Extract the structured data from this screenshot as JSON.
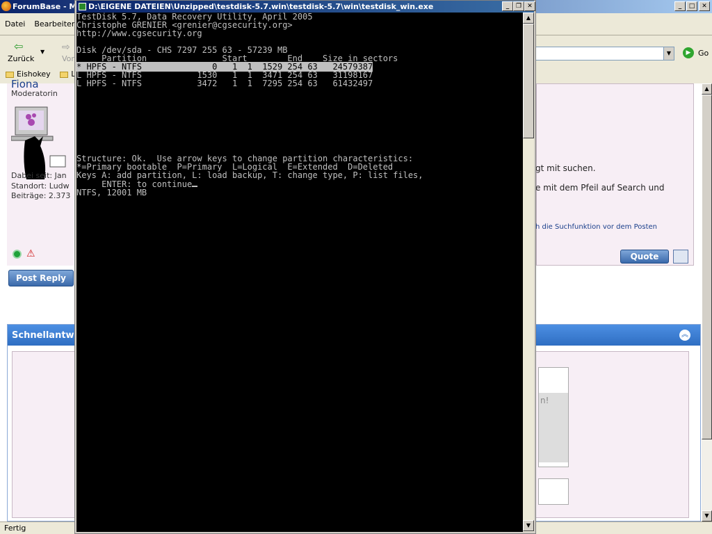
{
  "browser": {
    "title": "ForumBase - M",
    "menu": [
      "Datei",
      "Bearbeiten"
    ],
    "back_label": "Zurück",
    "forward_label": "Vor",
    "go_label": "Go",
    "bookmarks": [
      "Eishokey",
      "L"
    ],
    "status": "Fertig"
  },
  "forum": {
    "username": "Fiona",
    "rank": "Moderatorin",
    "joined": "Dabei seit: Jan",
    "location": "Standort: Ludw",
    "posts": "Beiträge: 2.373",
    "post_reply": "Post Reply",
    "quote": "Quote",
    "line1": "gt mit suchen.",
    "line2": "e mit dem Pfeil auf Search und",
    "line3": "h die Suchfunktion vor dem Posten",
    "quick_reply": "Schnellantw",
    "faded_text": "n!"
  },
  "console": {
    "title": "D:\\EIGENE DATEIEN\\Unzipped\\testdisk-5.7.win\\testdisk-5.7\\win\\testdisk_win.exe",
    "header": [
      "TestDisk 5.7, Data Recovery Utility, April 2005",
      "Christophe GRENIER <grenier@cgsecurity.org>",
      "http://www.cgsecurity.org"
    ],
    "disk_line": "Disk /dev/sda - CHS 7297 255 63 - 57239 MB",
    "table_header": "     Partition               Start        End    Size in sectors",
    "partitions": [
      "* HPFS - NTFS              0   1  1  1529 254 63   24579387",
      "L HPFS - NTFS           1530   1  1  3471 254 63   31198167",
      "L HPFS - NTFS           3472   1  1  7295 254 63   61432497"
    ],
    "footer": [
      "Structure: Ok.  Use arrow keys to change partition characteristics:",
      "*=Primary bootable  P=Primary  L=Logical  E=Extended  D=Deleted",
      "Keys A: add partition, L: load backup, T: change type, P: list files,",
      "     ENTER: to continue"
    ],
    "status_line": "NTFS, 12001 MB"
  }
}
